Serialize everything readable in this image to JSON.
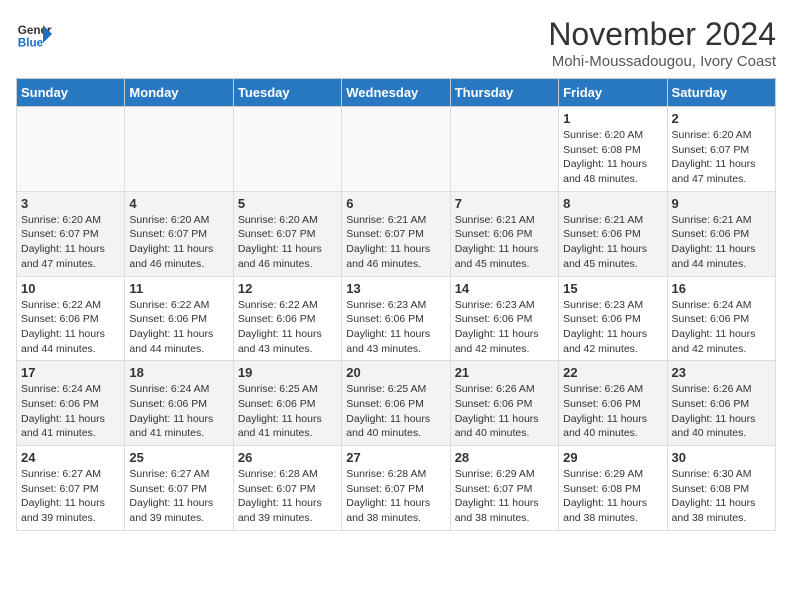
{
  "header": {
    "logo_general": "General",
    "logo_blue": "Blue",
    "month_title": "November 2024",
    "location": "Mohi-Moussadougou, Ivory Coast"
  },
  "weekdays": [
    "Sunday",
    "Monday",
    "Tuesday",
    "Wednesday",
    "Thursday",
    "Friday",
    "Saturday"
  ],
  "weeks": [
    [
      {
        "day": "",
        "info": ""
      },
      {
        "day": "",
        "info": ""
      },
      {
        "day": "",
        "info": ""
      },
      {
        "day": "",
        "info": ""
      },
      {
        "day": "",
        "info": ""
      },
      {
        "day": "1",
        "info": "Sunrise: 6:20 AM\nSunset: 6:08 PM\nDaylight: 11 hours and 48 minutes."
      },
      {
        "day": "2",
        "info": "Sunrise: 6:20 AM\nSunset: 6:07 PM\nDaylight: 11 hours and 47 minutes."
      }
    ],
    [
      {
        "day": "3",
        "info": "Sunrise: 6:20 AM\nSunset: 6:07 PM\nDaylight: 11 hours and 47 minutes."
      },
      {
        "day": "4",
        "info": "Sunrise: 6:20 AM\nSunset: 6:07 PM\nDaylight: 11 hours and 46 minutes."
      },
      {
        "day": "5",
        "info": "Sunrise: 6:20 AM\nSunset: 6:07 PM\nDaylight: 11 hours and 46 minutes."
      },
      {
        "day": "6",
        "info": "Sunrise: 6:21 AM\nSunset: 6:07 PM\nDaylight: 11 hours and 46 minutes."
      },
      {
        "day": "7",
        "info": "Sunrise: 6:21 AM\nSunset: 6:06 PM\nDaylight: 11 hours and 45 minutes."
      },
      {
        "day": "8",
        "info": "Sunrise: 6:21 AM\nSunset: 6:06 PM\nDaylight: 11 hours and 45 minutes."
      },
      {
        "day": "9",
        "info": "Sunrise: 6:21 AM\nSunset: 6:06 PM\nDaylight: 11 hours and 44 minutes."
      }
    ],
    [
      {
        "day": "10",
        "info": "Sunrise: 6:22 AM\nSunset: 6:06 PM\nDaylight: 11 hours and 44 minutes."
      },
      {
        "day": "11",
        "info": "Sunrise: 6:22 AM\nSunset: 6:06 PM\nDaylight: 11 hours and 44 minutes."
      },
      {
        "day": "12",
        "info": "Sunrise: 6:22 AM\nSunset: 6:06 PM\nDaylight: 11 hours and 43 minutes."
      },
      {
        "day": "13",
        "info": "Sunrise: 6:23 AM\nSunset: 6:06 PM\nDaylight: 11 hours and 43 minutes."
      },
      {
        "day": "14",
        "info": "Sunrise: 6:23 AM\nSunset: 6:06 PM\nDaylight: 11 hours and 42 minutes."
      },
      {
        "day": "15",
        "info": "Sunrise: 6:23 AM\nSunset: 6:06 PM\nDaylight: 11 hours and 42 minutes."
      },
      {
        "day": "16",
        "info": "Sunrise: 6:24 AM\nSunset: 6:06 PM\nDaylight: 11 hours and 42 minutes."
      }
    ],
    [
      {
        "day": "17",
        "info": "Sunrise: 6:24 AM\nSunset: 6:06 PM\nDaylight: 11 hours and 41 minutes."
      },
      {
        "day": "18",
        "info": "Sunrise: 6:24 AM\nSunset: 6:06 PM\nDaylight: 11 hours and 41 minutes."
      },
      {
        "day": "19",
        "info": "Sunrise: 6:25 AM\nSunset: 6:06 PM\nDaylight: 11 hours and 41 minutes."
      },
      {
        "day": "20",
        "info": "Sunrise: 6:25 AM\nSunset: 6:06 PM\nDaylight: 11 hours and 40 minutes."
      },
      {
        "day": "21",
        "info": "Sunrise: 6:26 AM\nSunset: 6:06 PM\nDaylight: 11 hours and 40 minutes."
      },
      {
        "day": "22",
        "info": "Sunrise: 6:26 AM\nSunset: 6:06 PM\nDaylight: 11 hours and 40 minutes."
      },
      {
        "day": "23",
        "info": "Sunrise: 6:26 AM\nSunset: 6:06 PM\nDaylight: 11 hours and 40 minutes."
      }
    ],
    [
      {
        "day": "24",
        "info": "Sunrise: 6:27 AM\nSunset: 6:07 PM\nDaylight: 11 hours and 39 minutes."
      },
      {
        "day": "25",
        "info": "Sunrise: 6:27 AM\nSunset: 6:07 PM\nDaylight: 11 hours and 39 minutes."
      },
      {
        "day": "26",
        "info": "Sunrise: 6:28 AM\nSunset: 6:07 PM\nDaylight: 11 hours and 39 minutes."
      },
      {
        "day": "27",
        "info": "Sunrise: 6:28 AM\nSunset: 6:07 PM\nDaylight: 11 hours and 38 minutes."
      },
      {
        "day": "28",
        "info": "Sunrise: 6:29 AM\nSunset: 6:07 PM\nDaylight: 11 hours and 38 minutes."
      },
      {
        "day": "29",
        "info": "Sunrise: 6:29 AM\nSunset: 6:08 PM\nDaylight: 11 hours and 38 minutes."
      },
      {
        "day": "30",
        "info": "Sunrise: 6:30 AM\nSunset: 6:08 PM\nDaylight: 11 hours and 38 minutes."
      }
    ]
  ]
}
